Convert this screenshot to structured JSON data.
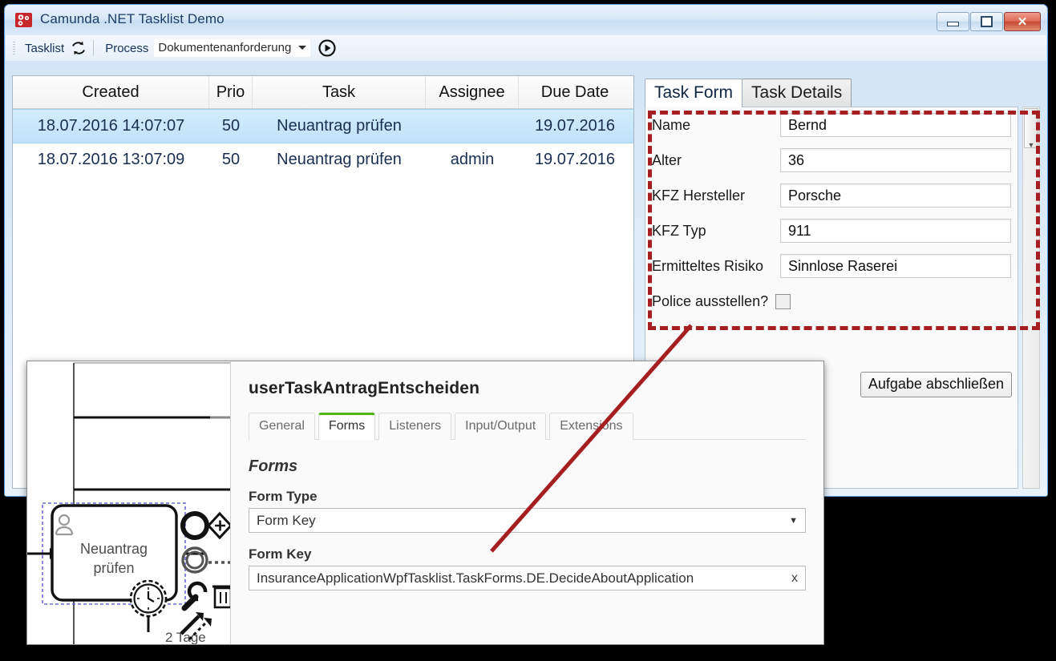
{
  "window": {
    "title": "Camunda .NET Tasklist Demo",
    "icon": "camunda-logo-icon",
    "controls": {
      "minimize": "minimize",
      "maximize": "maximize",
      "close": "close"
    }
  },
  "toolbar": {
    "tasklist_label": "Tasklist",
    "refresh_icon": "refresh-icon",
    "process_label": "Process",
    "process_value": "Dokumentenanforderung",
    "start_icon": "play-circle-icon"
  },
  "task_grid": {
    "columns": [
      "Created",
      "Prio",
      "Task",
      "Assignee",
      "Due Date"
    ],
    "rows": [
      {
        "created": "18.07.2016 14:07:07",
        "prio": "50",
        "task": "Neuantrag prüfen",
        "assignee": "",
        "due": "19.07.2016",
        "selected": true
      },
      {
        "created": "18.07.2016 13:07:09",
        "prio": "50",
        "task": "Neuantrag prüfen",
        "assignee": "admin",
        "due": "19.07.2016",
        "selected": false
      }
    ]
  },
  "right_panel": {
    "tabs": [
      {
        "label": "Task Form",
        "active": true
      },
      {
        "label": "Task Details",
        "active": false
      }
    ],
    "form_fields": [
      {
        "label": "Name",
        "value": "Bernd"
      },
      {
        "label": "Alter",
        "value": "36"
      },
      {
        "label": "KFZ Hersteller",
        "value": "Porsche"
      },
      {
        "label": "KFZ Typ",
        "value": "911"
      },
      {
        "label": "Ermitteltes Risiko",
        "value": "Sinnlose Raserei"
      }
    ],
    "checkbox": {
      "label": "Police ausstellen?",
      "checked": false
    },
    "submit_label": "Aufgabe abschließen"
  },
  "modeler": {
    "diagram": {
      "task_label": "Neuantrag prüfen",
      "boundary_timer_label": "2 Tage",
      "task_type_icon": "user-task-icon",
      "timer_icon": "timer-event-icon",
      "context_pad_icons": [
        "end-event-icon",
        "intermediate-event-icon",
        "gateway-icon",
        "wrench-icon",
        "trash-icon",
        "append-task-icon",
        "connection-icon"
      ]
    },
    "properties": {
      "title": "userTaskAntragEntscheiden",
      "tabs": [
        {
          "label": "General",
          "active": false
        },
        {
          "label": "Forms",
          "active": true
        },
        {
          "label": "Listeners",
          "active": false
        },
        {
          "label": "Input/Output",
          "active": false
        },
        {
          "label": "Extensions",
          "active": false
        }
      ],
      "section_heading": "Forms",
      "form_type_label": "Form Type",
      "form_type_value": "Form Key",
      "form_key_label": "Form Key",
      "form_key_value": "InsuranceApplicationWpfTasklist.TaskForms.DE.DecideAboutApplication",
      "clear_label": "x"
    }
  },
  "annotation": {
    "highlight_color": "#a51e22",
    "connector_color": "#a51e22"
  }
}
